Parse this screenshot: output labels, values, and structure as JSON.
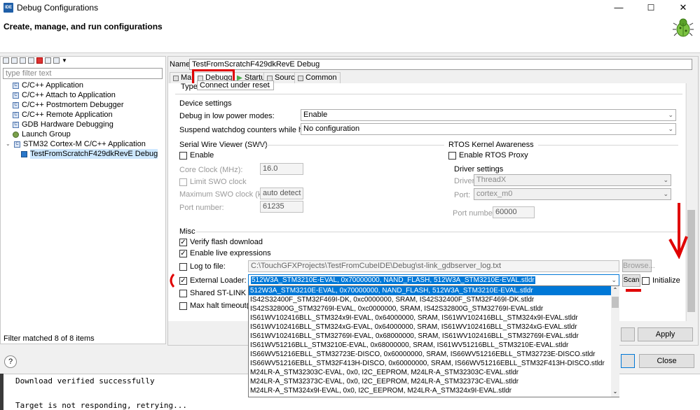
{
  "window": {
    "title": "Debug Configurations",
    "icon_text": "IDE",
    "minimize": "—",
    "maximize": "☐",
    "close": "✕"
  },
  "header": {
    "title": "Create, manage, and run configurations",
    "icon": "bug-icon"
  },
  "left": {
    "filter_placeholder": "type filter text",
    "tree": [
      {
        "label": "C/C++ Application",
        "level": 1
      },
      {
        "label": "C/C++ Attach to Application",
        "level": 1
      },
      {
        "label": "C/C++ Postmortem Debugger",
        "level": 1
      },
      {
        "label": "C/C++ Remote Application",
        "level": 1
      },
      {
        "label": "GDB Hardware Debugging",
        "level": 1
      },
      {
        "label": "Launch Group",
        "level": 1
      },
      {
        "label": "STM32 Cortex-M C/C++ Application",
        "level": 1,
        "expanded": true
      },
      {
        "label": "TestFromScratchF429dkRevE Debug",
        "level": 2,
        "selected": true
      }
    ],
    "status": "Filter matched 8 of 8 items"
  },
  "config": {
    "name_label": "Name:",
    "name_value": "TestFromScratchF429dkRevE Debug",
    "tabs": [
      "Main",
      "Debugger",
      "Startup",
      "Source",
      "Common"
    ],
    "active_tab": "Debugger"
  },
  "debugger": {
    "type_label": "Type:",
    "type_value": "Connect under reset",
    "device_settings": {
      "title": "Device settings",
      "low_power_label": "Debug in low power modes:",
      "low_power_value": "Enable",
      "watchdog_label": "Suspend watchdog counters while halted:",
      "watchdog_value": "No configuration"
    },
    "swv": {
      "title": "Serial Wire Viewer (SWV)",
      "enable_label": "Enable",
      "core_clock_label": "Core Clock (MHz):",
      "core_clock_value": "16.0",
      "limit_label": "Limit SWO clock",
      "max_swo_label": "Maximum SWO clock (kHz):",
      "max_swo_value": "auto detect",
      "port_label": "Port number:",
      "port_value": "61235"
    },
    "rtos": {
      "title": "RTOS Kernel Awareness",
      "enable_label": "Enable RTOS Proxy",
      "driver_title": "Driver settings",
      "driver_label": "Driver:",
      "driver_value": "ThreadX",
      "port_label": "Port:",
      "port_value": "cortex_m0",
      "port_number_label": "Port number:",
      "port_number_value": "60000"
    },
    "misc": {
      "title": "Misc",
      "verify_label": "Verify flash download",
      "live_label": "Enable live expressions",
      "log_label": "Log to file:",
      "log_value": "C:\\TouchGFXProjects\\TestFromCubeIDE\\Debug\\st-link_gdbserver_log.txt",
      "browse_label": "Browse...",
      "external_loader_label": "External Loader:",
      "external_loader_value": "512W3A_STM3210E-EVAL, 0x70000000, NAND_FLASH, 512W3A_STM3210E-EVAL.stldr",
      "scan_label": "Scan",
      "initialize_label": "Initialize",
      "shared_label": "Shared ST-LINK",
      "halt_label": "Max halt timeout(s):"
    }
  },
  "loader_options": [
    "512W3A_STM3210E-EVAL, 0x70000000, NAND_FLASH, 512W3A_STM3210E-EVAL.stldr",
    "IS42S32400F_STM32F469I-DK, 0xc0000000, SRAM, IS42S32400F_STM32F469I-DK.stldr",
    "IS42S32800G_STM32769I-EVAL, 0xc0000000, SRAM, IS42S32800G_STM32769I-EVAL.stldr",
    "IS61WV102416BLL_STM324x9I-EVAL, 0x64000000, SRAM, IS61WV102416BLL_STM324x9I-EVAL.stldr",
    "IS61WV102416BLL_STM324xG-EVAL, 0x64000000, SRAM, IS61WV102416BLL_STM324xG-EVAL.stldr",
    "IS61WV102416BLL_STM32769I-EVAL, 0x68000000, SRAM, IS61WV102416BLL_STM32769I-EVAL.stldr",
    "IS61WV51216BLL_STM3210E-EVAL, 0x68000000, SRAM, IS61WV51216BLL_STM3210E-EVAL.stldr",
    "IS66WV51216EBLL_STM32723E-DISCO, 0x60000000, SRAM, IS66WV51216EBLL_STM32723E-DISCO.stldr",
    "IS66WV51216EBLL_STM32F413H-DISCO, 0x60000000, SRAM, IS66WV51216EBLL_STM32F413H-DISCO.stldr",
    "M24LR-A_STM32303C-EVAL, 0x0, I2C_EEPROM, M24LR-A_STM32303C-EVAL.stldr",
    "M24LR-A_STM32373C-EVAL, 0x0, I2C_EEPROM, M24LR-A_STM32373C-EVAL.stldr",
    "M24LR-A_STM324x9I-EVAL, 0x0, I2C_EEPROM, M24LR-A_STM324x9I-EVAL.stldr"
  ],
  "buttons": {
    "apply": "Apply",
    "close": "Close",
    "help": "?"
  },
  "console": {
    "line1": "Download verified successfully",
    "line2": "Target is not responding, retrying..."
  }
}
